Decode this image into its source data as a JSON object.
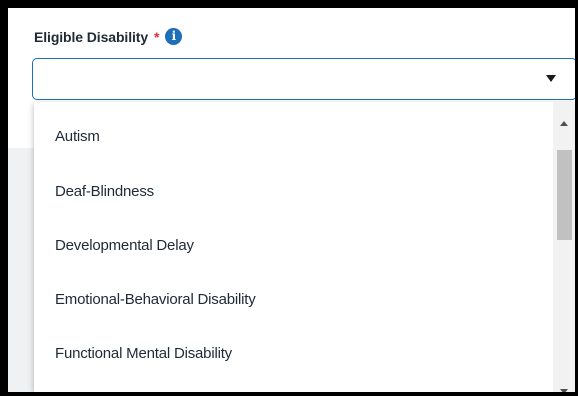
{
  "field": {
    "label": "Eligible Disability",
    "required_mark": "*",
    "info_icon": "info-icon",
    "value": ""
  },
  "dropdown": {
    "options": [
      "Autism",
      "Deaf-Blindness",
      "Developmental Delay",
      "Emotional-Behavioral Disability",
      "Functional Mental Disability"
    ]
  },
  "colors": {
    "accent": "#1f6fb8",
    "required": "#d6343e",
    "text": "#1f2a36",
    "panel": "#f0f1f2"
  }
}
